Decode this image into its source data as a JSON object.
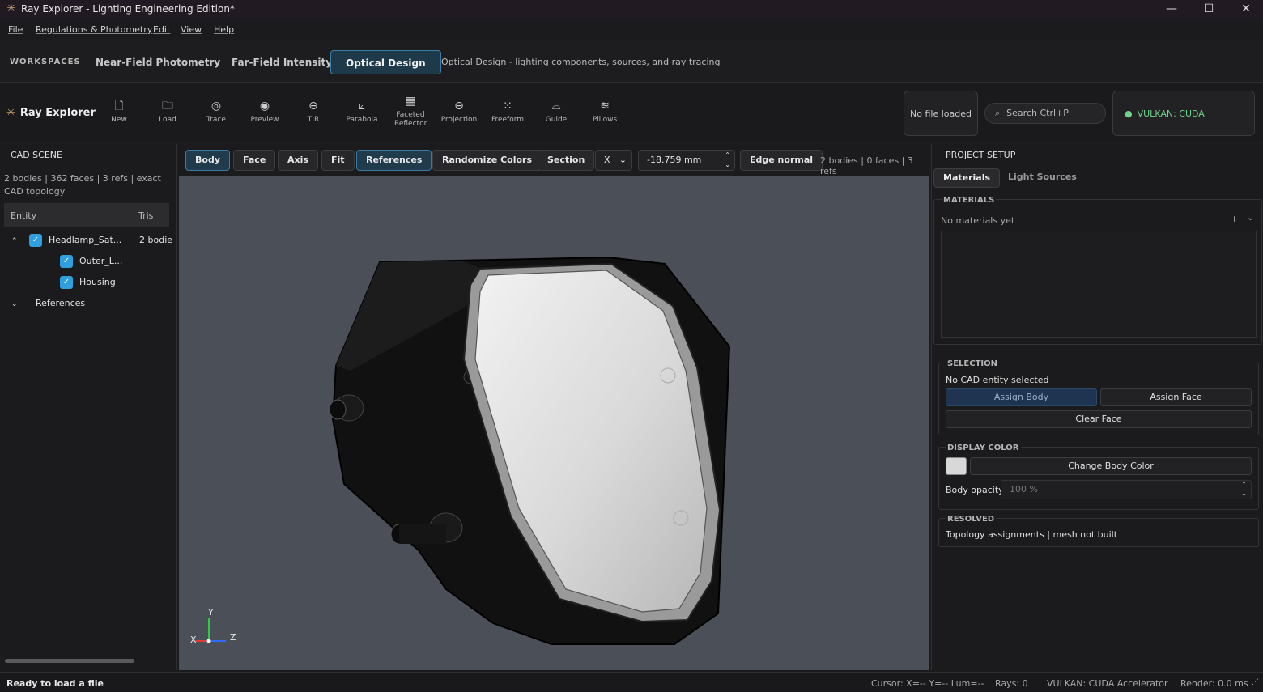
{
  "window": {
    "title": "Ray Explorer - Lighting Engineering Edition*",
    "min_icon": "minimize-icon",
    "max_icon": "maximize-icon",
    "close_icon": "close-icon"
  },
  "menu": [
    "File",
    "Regulations & Photometry",
    "Edit",
    "View",
    "Help"
  ],
  "workspaces": {
    "label": "WORKSPACES",
    "tabs": [
      "Near-Field Photometry",
      "Far-Field Intensity",
      "Optical Design"
    ],
    "active": "Optical Design",
    "description": "Optical Design - lighting components, sources, and ray tracing"
  },
  "toolbar": {
    "brand": "Ray Explorer",
    "tools": [
      {
        "label": "New",
        "icon": "new-file-icon"
      },
      {
        "label": "Load",
        "icon": "folder-icon"
      },
      {
        "label": "Trace",
        "icon": "eye-icon"
      },
      {
        "label": "Preview",
        "icon": "preview-eye-icon"
      },
      {
        "label": "TIR",
        "icon": "tir-lens-icon"
      },
      {
        "label": "Parabola",
        "icon": "parabola-icon"
      },
      {
        "label": "Faceted Reflector",
        "icon": "faceted-reflector-icon"
      },
      {
        "label": "Projection",
        "icon": "projection-lens-icon"
      },
      {
        "label": "Freeform",
        "icon": "grid-dots-icon"
      },
      {
        "label": "Guide",
        "icon": "light-guide-icon"
      },
      {
        "label": "Pillows",
        "icon": "pillows-wave-icon"
      }
    ],
    "file_status": "No file loaded",
    "search_placeholder": "Search  Ctrl+P",
    "accelerator": "VULKAN: CUDA Accelerator",
    "accent_green": "#6fd38a"
  },
  "cad_scene": {
    "title": "CAD SCENE",
    "info": "2 bodies | 362 faces | 3 refs | exact CAD topology",
    "columns": [
      "Entity",
      "Tris"
    ],
    "tree": [
      {
        "name": "Headlamp_Sat...",
        "tris": "2 bodie",
        "checked": true,
        "expanded": true
      },
      {
        "name": "Outer_L...",
        "checked": true
      },
      {
        "name": "Housing",
        "checked": true
      },
      {
        "name": "References",
        "expanded": false
      }
    ]
  },
  "view_toolbar": {
    "buttons": [
      "Body",
      "Face",
      "Axis",
      "Fit",
      "References",
      "Randomize Colors",
      "Section"
    ],
    "active_buttons": [
      "Body",
      "References"
    ],
    "axis_select": "X",
    "section_value": "-18.759 mm",
    "edge_mode": "Edge normal",
    "stats": "2 bodies | 0 faces | 3 refs"
  },
  "viewport": {
    "background": "#4a4f58",
    "axes": {
      "y": "Y",
      "x": "X",
      "z": "Z"
    }
  },
  "project_setup": {
    "title": "PROJECT SETUP",
    "tabs": [
      "Materials",
      "Light Sources"
    ],
    "active_tab": "Materials",
    "materials": {
      "title": "MATERIALS",
      "empty_text": "No materials yet",
      "add": "+",
      "expand": "⌄"
    },
    "selection": {
      "title": "SELECTION",
      "status": "No CAD entity selected",
      "assign_body": "Assign Body",
      "assign_face": "Assign Face",
      "clear_face": "Clear Face"
    },
    "display_color": {
      "title": "DISPLAY COLOR",
      "swatch": "#d8d8d8",
      "change": "Change Body Color",
      "opacity_label": "Body opacity",
      "opacity_value": "100 %"
    },
    "resolved": {
      "title": "RESOLVED",
      "text": "Topology assignments | mesh not built"
    }
  },
  "status": {
    "left": "Ready to load a file",
    "cursor": "Cursor: X=-- Y=-- Lum=--",
    "rays": "Rays: 0",
    "backend": "VULKAN: CUDA Accelerator",
    "render": "Render: 0.0 ms"
  }
}
